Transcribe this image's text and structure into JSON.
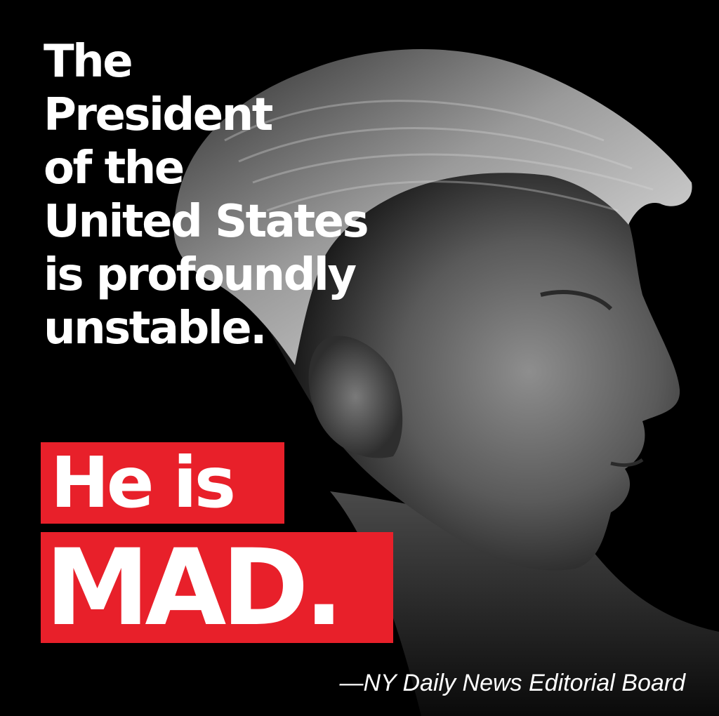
{
  "headline": {
    "lines": [
      "The",
      "President",
      "of the",
      "United States",
      "is profoundly",
      "unstable."
    ]
  },
  "emphasis": {
    "line1": "He is",
    "line2": "MAD."
  },
  "attribution": "—NY Daily News Editorial Board",
  "colors": {
    "background": "#000000",
    "text": "#ffffff",
    "highlight": "#e8202a"
  }
}
